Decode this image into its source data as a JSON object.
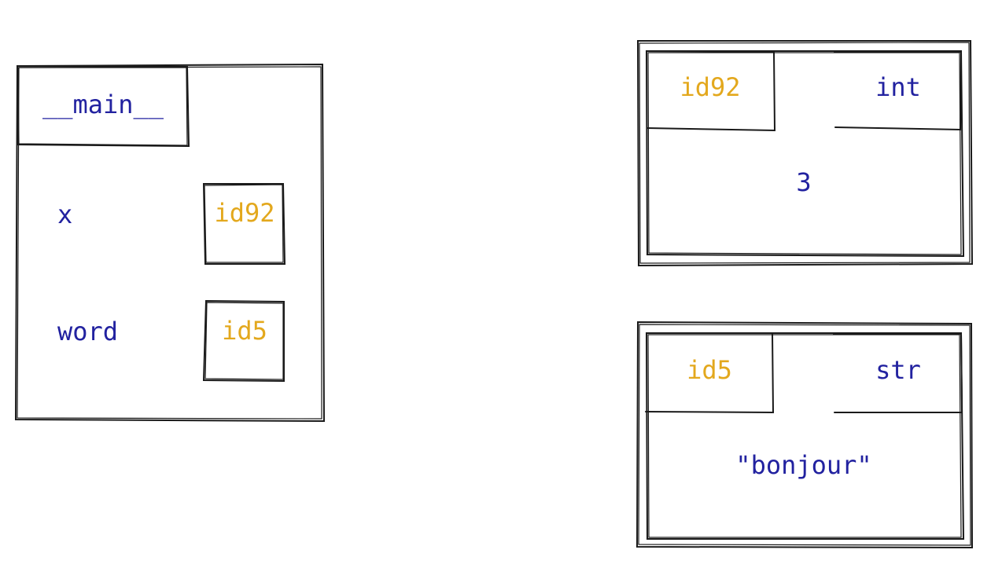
{
  "colors": {
    "name_text": "#2222a0",
    "id_text": "#e3a81d",
    "stroke": "#1a1a1a"
  },
  "frame": {
    "title": "__main__",
    "variables": [
      {
        "name": "x",
        "id": "id92"
      },
      {
        "name": "word",
        "id": "id5"
      }
    ]
  },
  "objects": [
    {
      "id": "id92",
      "type": "int",
      "value": "3"
    },
    {
      "id": "id5",
      "type": "str",
      "value": "\"bonjour\""
    }
  ]
}
